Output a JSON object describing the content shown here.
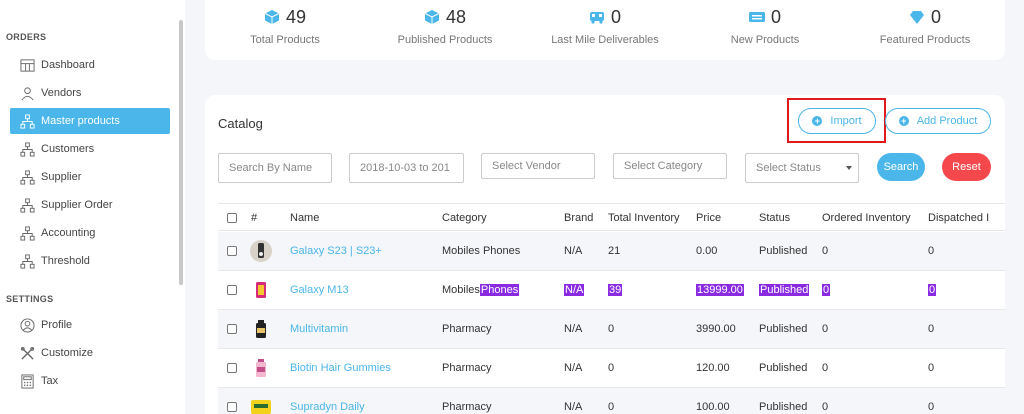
{
  "sidebar": {
    "orders_title": "ORDERS",
    "settings_title": "SETTINGS",
    "items": [
      {
        "label": "Dashboard",
        "icon": "dashboard-icon"
      },
      {
        "label": "Vendors",
        "icon": "user-icon"
      },
      {
        "label": "Master products",
        "icon": "hierarchy-icon"
      },
      {
        "label": "Customers",
        "icon": "hierarchy-icon"
      },
      {
        "label": "Supplier",
        "icon": "hierarchy-icon"
      },
      {
        "label": "Supplier Order",
        "icon": "hierarchy-icon"
      },
      {
        "label": "Accounting",
        "icon": "hierarchy-icon"
      },
      {
        "label": "Threshold",
        "icon": "hierarchy-icon"
      }
    ],
    "settings_items": [
      {
        "label": "Profile",
        "icon": "profile-icon"
      },
      {
        "label": "Customize",
        "icon": "tools-icon"
      },
      {
        "label": "Tax",
        "icon": "tax-icon"
      }
    ]
  },
  "stats": [
    {
      "value": "49",
      "label": "Total Products",
      "icon": "box-icon"
    },
    {
      "value": "48",
      "label": "Published Products",
      "icon": "box-icon"
    },
    {
      "value": "0",
      "label": "Last Mile Deliverables",
      "icon": "truck-icon"
    },
    {
      "value": "0",
      "label": "New Products",
      "icon": "new-badge-icon"
    },
    {
      "value": "0",
      "label": "Featured Products",
      "icon": "diamond-icon"
    }
  ],
  "catalog": {
    "title": "Catalog",
    "import_label": "Import",
    "add_label": "Add Product",
    "filters": {
      "search_placeholder": "Search By Name",
      "date_range": "2018-10-03 to 201",
      "vendor_placeholder": "Select Vendor",
      "category_placeholder": "Select Category",
      "status_placeholder": "Select Status"
    },
    "search_label": "Search",
    "reset_label": "Reset",
    "columns": [
      "#",
      "Name",
      "Category",
      "Brand",
      "Total Inventory",
      "Price",
      "Status",
      "Ordered Inventory",
      "Dispatched I"
    ],
    "rows": [
      {
        "name": "Galaxy S23 | S23+",
        "category": "Mobiles Phones",
        "brand": "N/A",
        "inventory": "21",
        "price": "0.00",
        "status": "Published",
        "ordered": "0",
        "dispatched": "0"
      },
      {
        "name": "Galaxy M13",
        "category_a": "Mobiles",
        "category_b": "Phones",
        "brand": "N/A",
        "inventory": "39",
        "price": "13999.00",
        "status": "Published",
        "ordered": "0",
        "dispatched": "0"
      },
      {
        "name": "Multivitamin",
        "category": "Pharmacy",
        "brand": "N/A",
        "inventory": "0",
        "price": "3990.00",
        "status": "Published",
        "ordered": "0",
        "dispatched": "0"
      },
      {
        "name": "Biotin Hair Gummies",
        "category": "Pharmacy",
        "brand": "N/A",
        "inventory": "0",
        "price": "120.00",
        "status": "Published",
        "ordered": "0",
        "dispatched": "0"
      },
      {
        "name": "Supradyn Daily",
        "category": "Pharmacy",
        "brand": "N/A",
        "inventory": "0",
        "price": "100.00",
        "status": "Published",
        "ordered": "0",
        "dispatched": "0"
      }
    ]
  },
  "colors": {
    "accent": "#4bb6e9",
    "danger": "#f5484d",
    "highlight": "#e0191c",
    "selection": "#8a2be2"
  }
}
